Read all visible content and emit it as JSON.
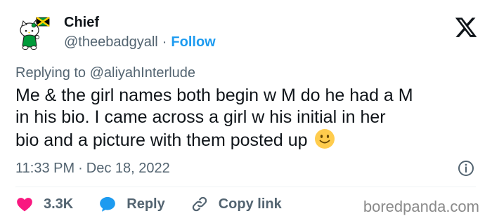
{
  "author": {
    "display_name": "Chief",
    "handle": "@theebadgyall",
    "separator": "·",
    "follow_label": "Follow"
  },
  "reply_context": {
    "text": "Replying to @aliyahInterlude"
  },
  "tweet": {
    "lines": [
      "Me & the girl names both begin w M do he had a M",
      "in his bio. I came across a girl w his initial in her",
      "bio and a picture with them posted up"
    ],
    "emoji": "slightly-smiling-face"
  },
  "meta": {
    "time": "11:33 PM",
    "separator": "·",
    "date": "Dec 18, 2022"
  },
  "actions": {
    "like_count": "3.3K",
    "reply_label": "Reply",
    "copy_link_label": "Copy link"
  },
  "watermark": "boredpanda.com",
  "icons": {
    "logo": "x-logo-icon",
    "info": "info-icon",
    "like": "heart-icon",
    "reply": "speech-bubble-icon",
    "copy": "link-icon"
  },
  "colors": {
    "text_primary": "#0f1419",
    "text_secondary": "#536471",
    "accent": "#1d9bf0",
    "like": "#f91880",
    "divider": "#eff3f4"
  }
}
